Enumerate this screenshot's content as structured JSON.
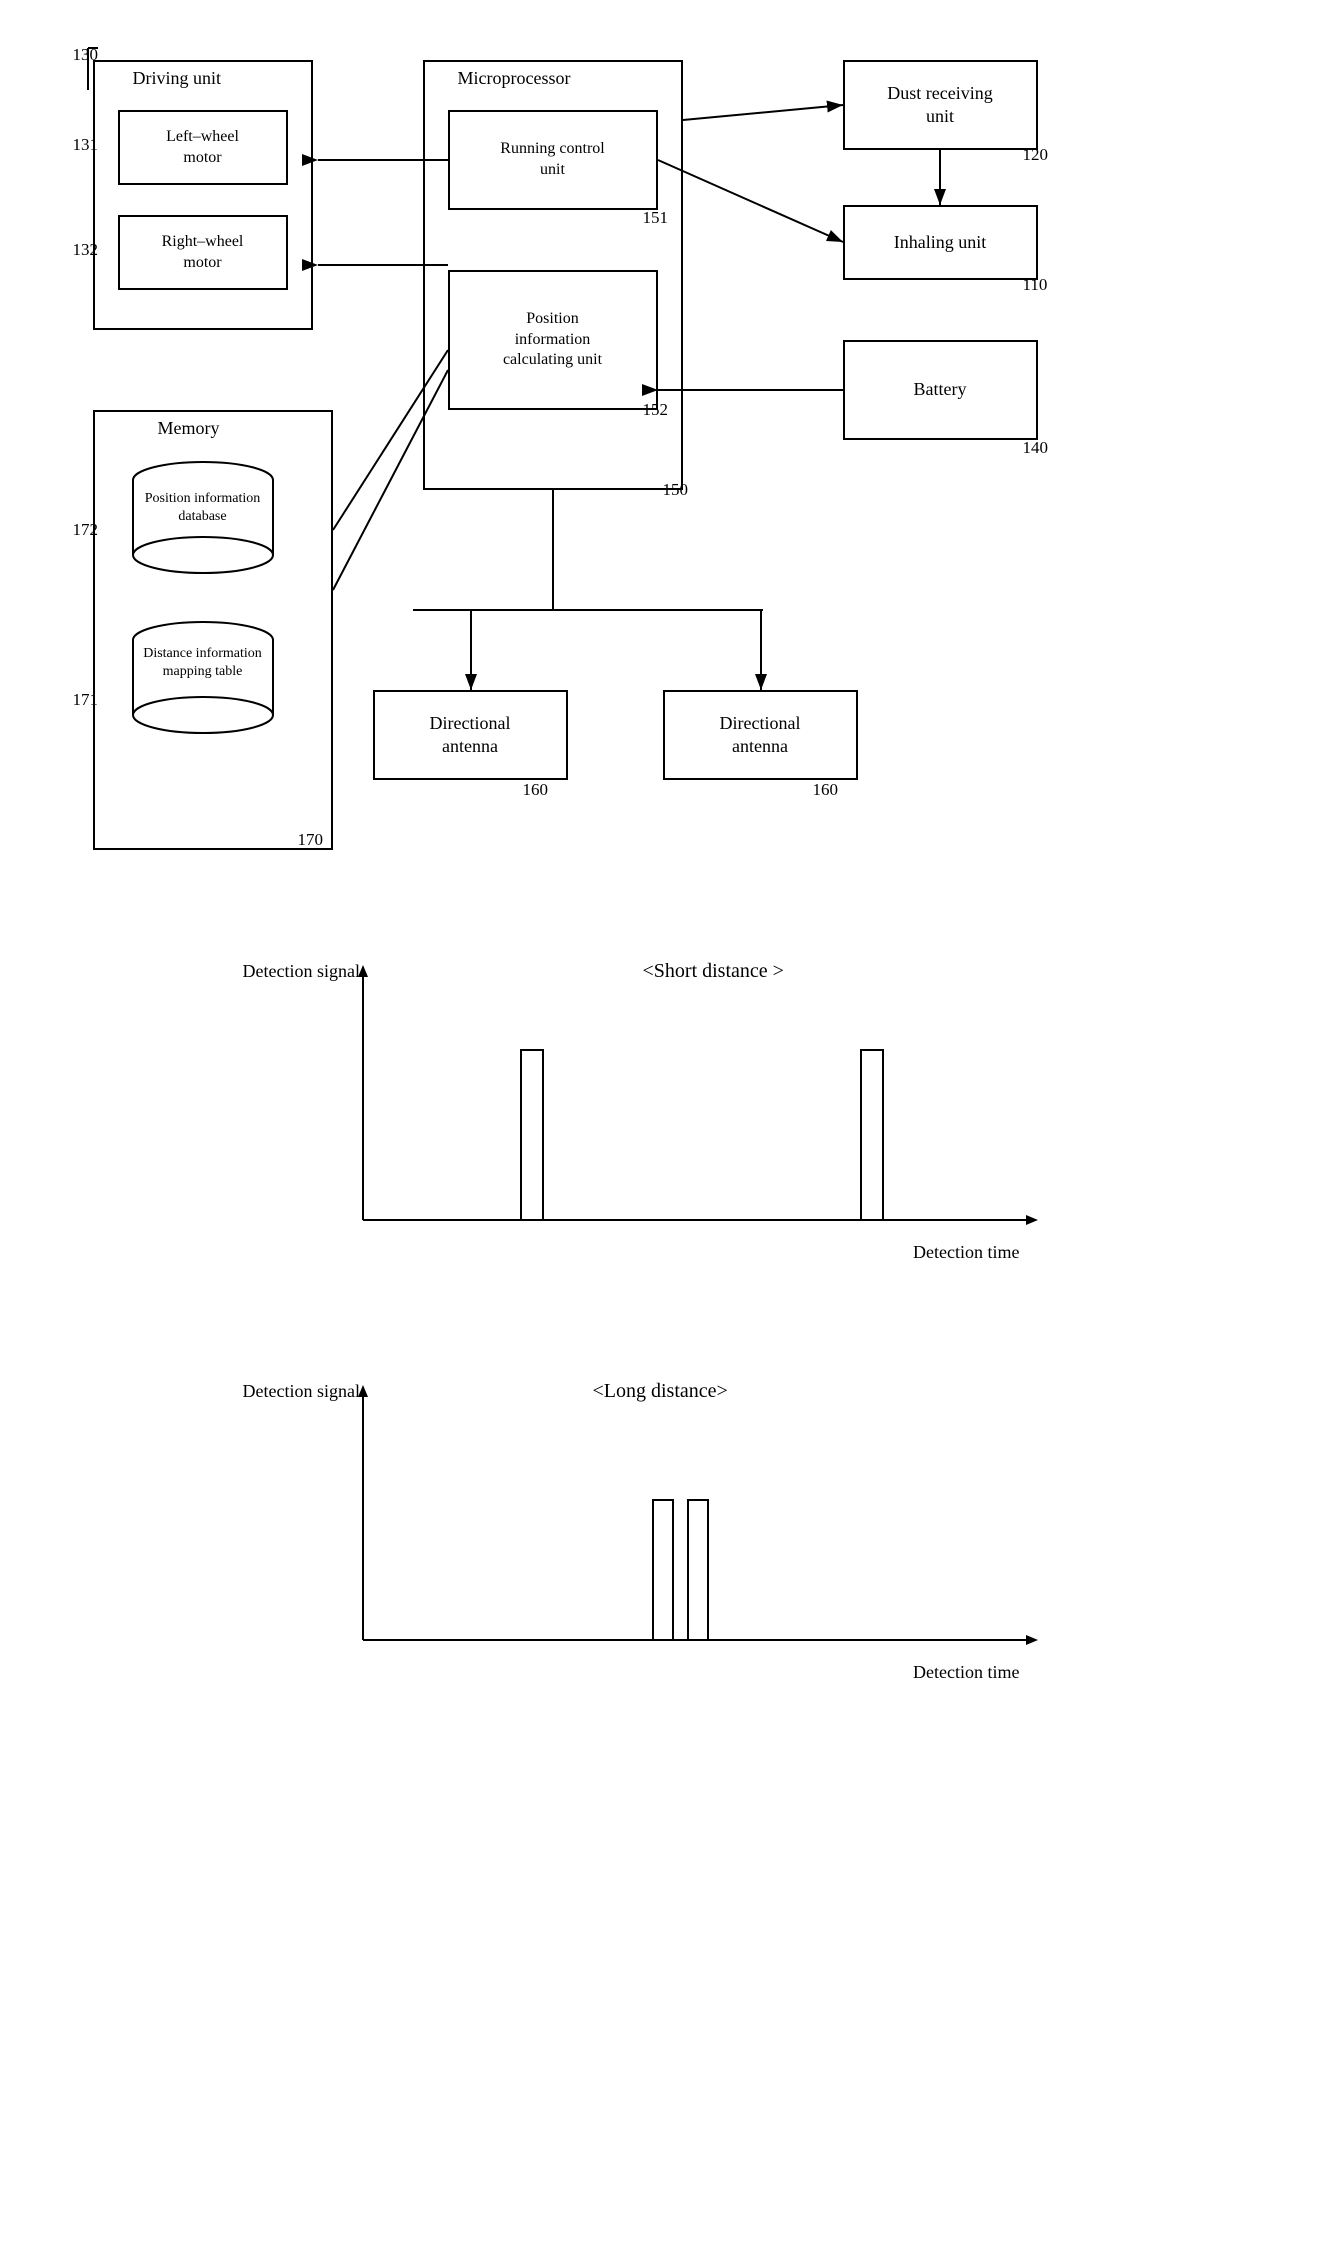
{
  "diagram1": {
    "label130": "130",
    "driving_unit": "Driving unit",
    "left_wheel": "Left–wheel\nmotor",
    "right_wheel": "Right–wheel\nmotor",
    "ref131": "131",
    "ref132": "132",
    "memory": "Memory",
    "pos_info_db": "Position\ninformation\ndatabase",
    "dist_info_map": "Distance\ninformation\nmapping table",
    "ref172": "172",
    "ref171": "171",
    "ref170": "170",
    "microprocessor": "Microprocessor",
    "running_control": "Running control\nunit",
    "ref151": "151",
    "pos_info_calc": "Position\ninformation\ncalculating unit",
    "ref152": "152",
    "ref150": "150",
    "battery": "Battery",
    "ref140": "140",
    "dust_receiving": "Dust receiving\nunit",
    "ref120": "120",
    "inhaling_unit": "Inhaling unit",
    "ref110": "110",
    "dir_antenna_left": "Directional\nantenna",
    "dir_antenna_right": "Directional\nantenna",
    "ref160_left": "160",
    "ref160_right": "160"
  },
  "chart1": {
    "title": "<Short distance >",
    "y_label": "Detection signal",
    "x_label": "Detection time"
  },
  "chart2": {
    "title": "<Long distance>",
    "y_label": "Detection signal",
    "x_label": "Detection time"
  }
}
